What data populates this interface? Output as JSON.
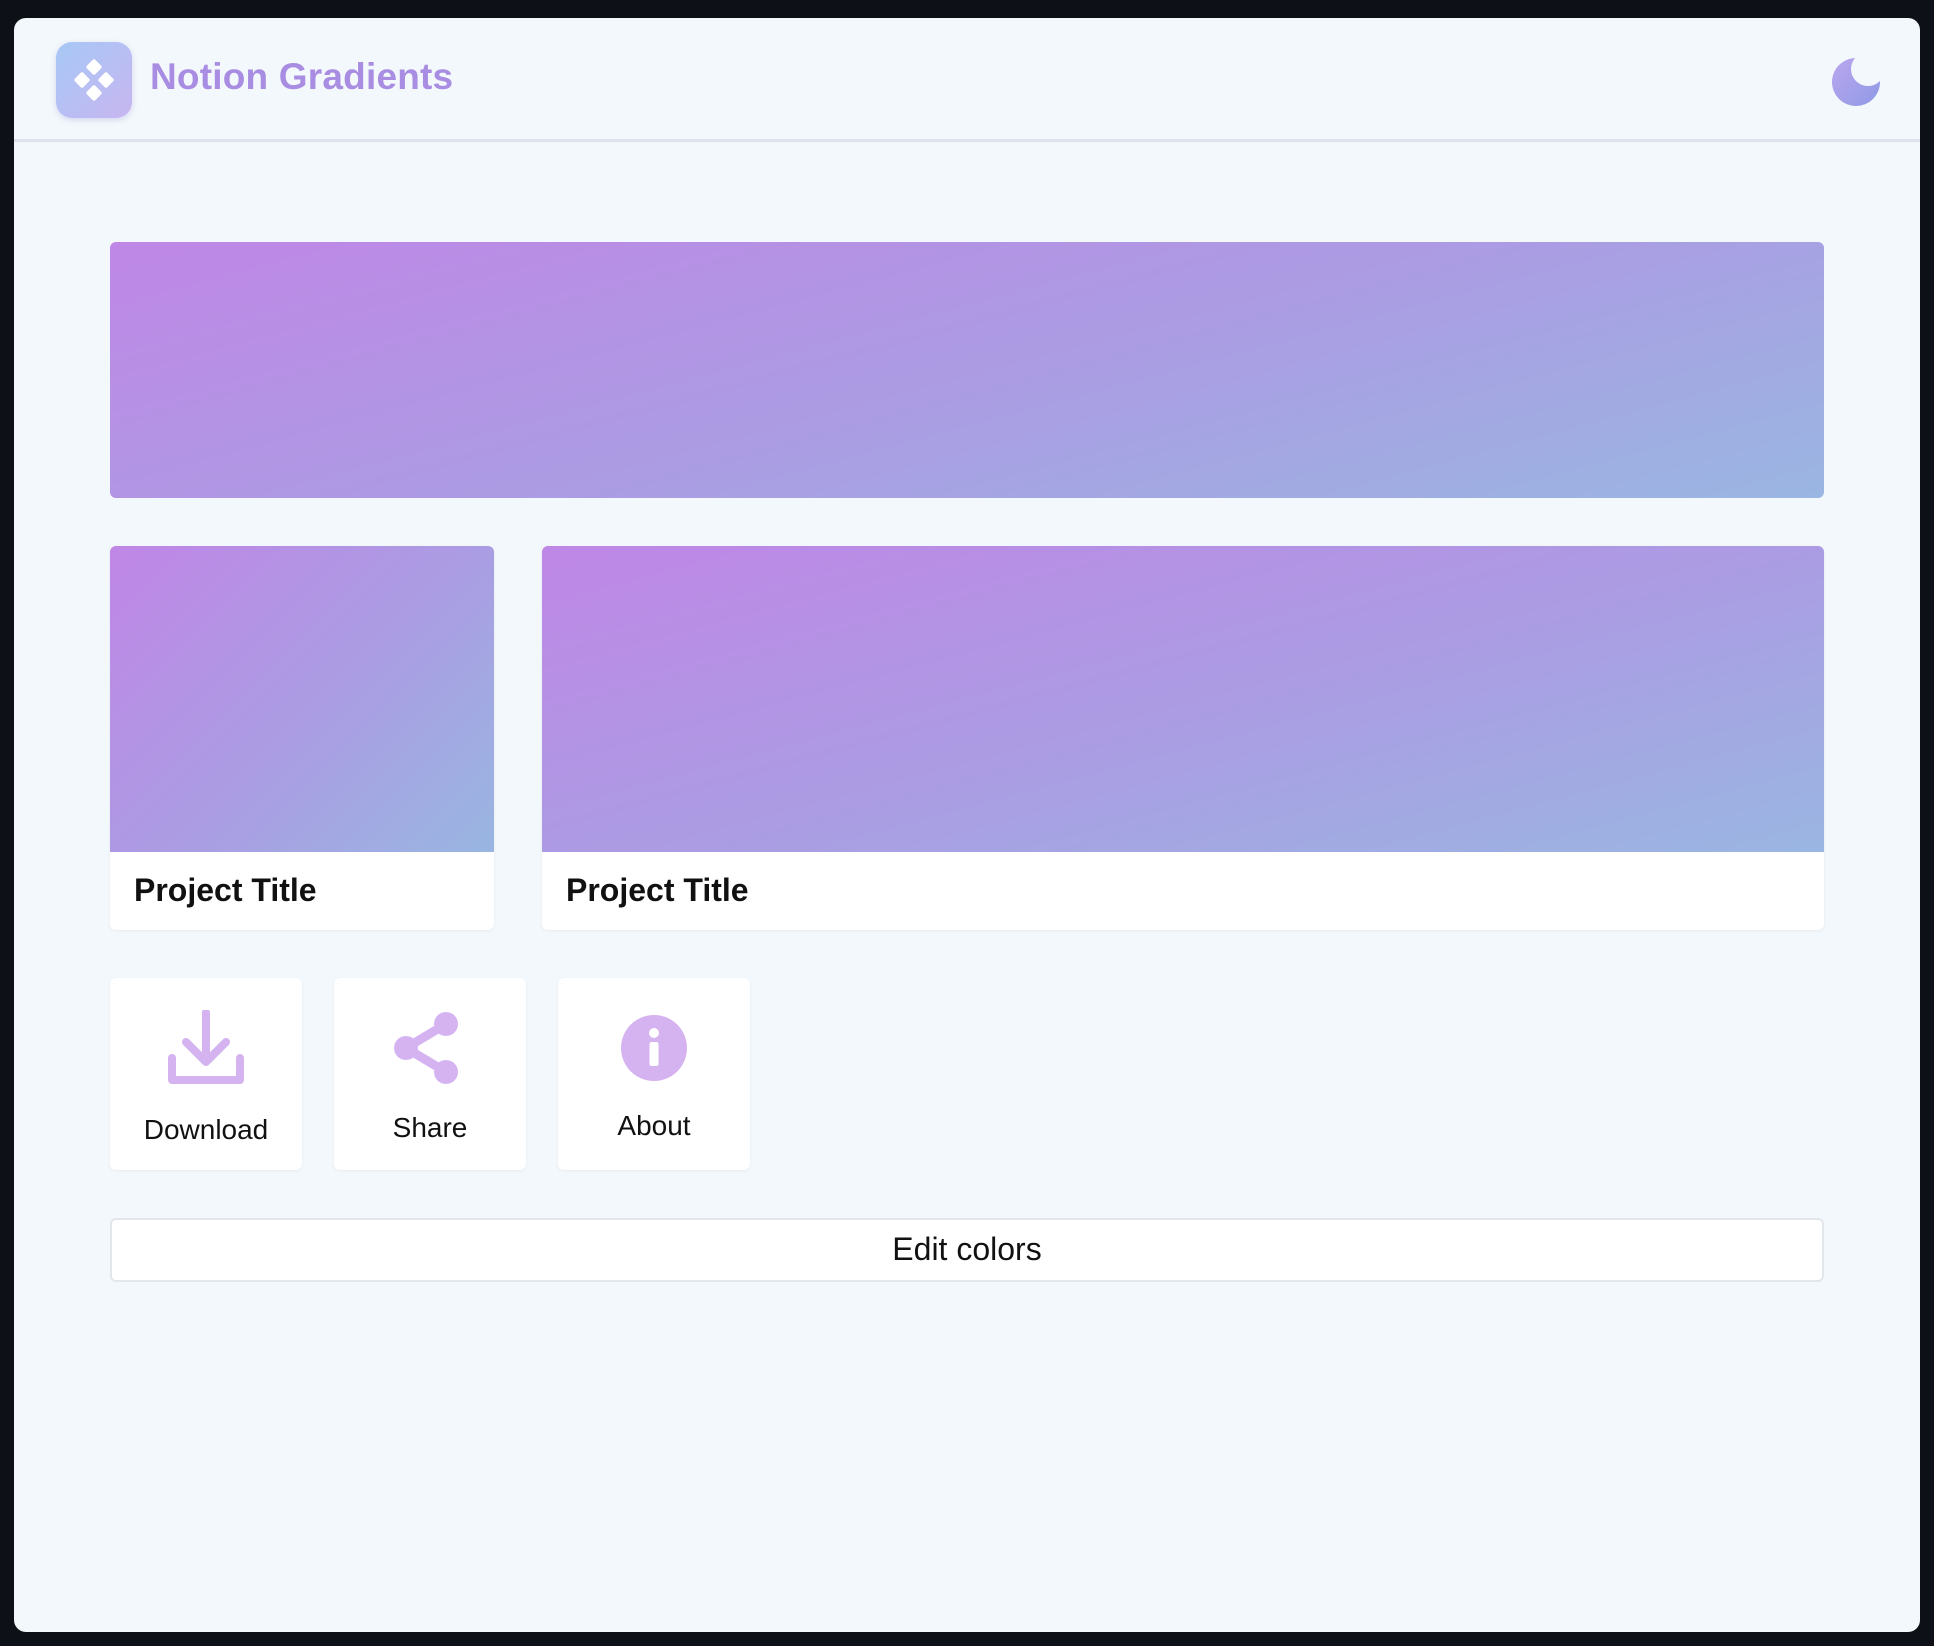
{
  "app": {
    "title": "Notion Gradients"
  },
  "icons": {
    "logo": "diamond-grid-icon",
    "theme_toggle": "moon-icon",
    "download": "download-icon",
    "share": "share-icon",
    "about": "info-icon"
  },
  "colors": {
    "background": "#f3f8fc",
    "accent": "#a98de2",
    "icon_fill": "#d5b3f1",
    "gradient_start": "#bf87e6",
    "gradient_end": "#9ab6e2"
  },
  "cards": [
    {
      "title": "Project Title"
    },
    {
      "title": "Project Title"
    }
  ],
  "actions": [
    {
      "label": "Download",
      "icon": "download-icon"
    },
    {
      "label": "Share",
      "icon": "share-icon"
    },
    {
      "label": "About",
      "icon": "info-icon"
    }
  ],
  "edit_button": {
    "label": "Edit colors"
  }
}
